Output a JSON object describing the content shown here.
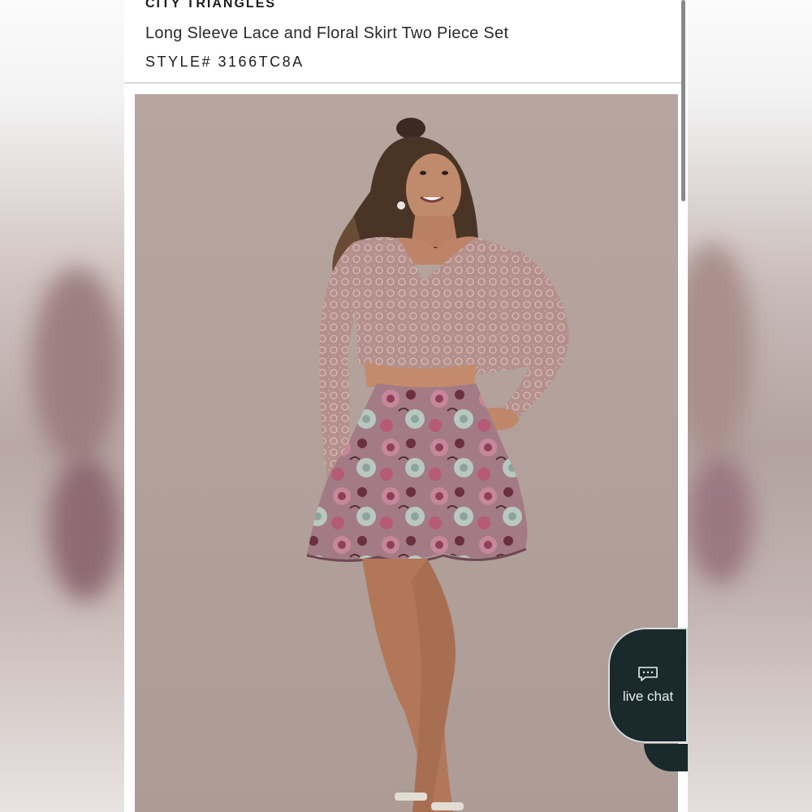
{
  "product": {
    "brand": "CITY TRIANGLES",
    "name": "Long Sleeve Lace and Floral Skirt Two Piece Set",
    "style": "STYLE# 3166TC8A"
  },
  "live_chat": {
    "label": "live chat",
    "icon": "chat-bubble-icon"
  },
  "colors": {
    "chat_bg": "#1a2a2c",
    "photo_bg": "#b3a19b",
    "top_lace": "#b48f8c",
    "skirt": "#9a6a78"
  }
}
